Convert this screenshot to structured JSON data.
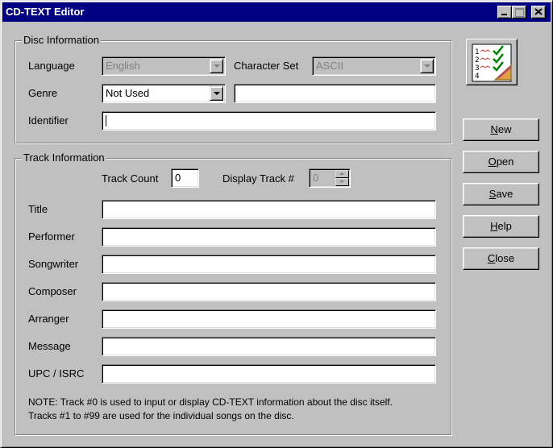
{
  "window": {
    "title": "CD-TEXT Editor"
  },
  "disc": {
    "legend": "Disc Information",
    "language_label": "Language",
    "language_value": "English",
    "charset_label": "Character Set",
    "charset_value": "ASCII",
    "genre_label": "Genre",
    "genre_value": "Not Used",
    "genre_text": "",
    "identifier_label": "Identifier",
    "identifier_value": ""
  },
  "track": {
    "legend": "Track Information",
    "count_label": "Track Count",
    "count_value": "0",
    "display_label": "Display Track #",
    "display_value": "0",
    "fields": [
      {
        "label": "Title",
        "value": ""
      },
      {
        "label": "Performer",
        "value": ""
      },
      {
        "label": "Songwriter",
        "value": ""
      },
      {
        "label": "Composer",
        "value": ""
      },
      {
        "label": "Arranger",
        "value": ""
      },
      {
        "label": "Message",
        "value": ""
      },
      {
        "label": "UPC / ISRC",
        "value": ""
      }
    ],
    "note_line1": "NOTE: Track #0 is used to input or display CD-TEXT information about the disc itself.",
    "note_line2": "Tracks #1 to #99 are used for the individual songs on the disc."
  },
  "buttons": {
    "new_mn": "N",
    "new_rest": "ew",
    "open_mn": "O",
    "open_rest": "pen",
    "save_mn": "S",
    "save_rest": "ave",
    "help_mn": "H",
    "help_rest": "elp",
    "close_mn": "C",
    "close_rest": "lose"
  },
  "icons": {
    "app": "checklist-icon",
    "minimize": "minimize-icon",
    "maximize": "maximize-icon",
    "close": "close-icon"
  }
}
